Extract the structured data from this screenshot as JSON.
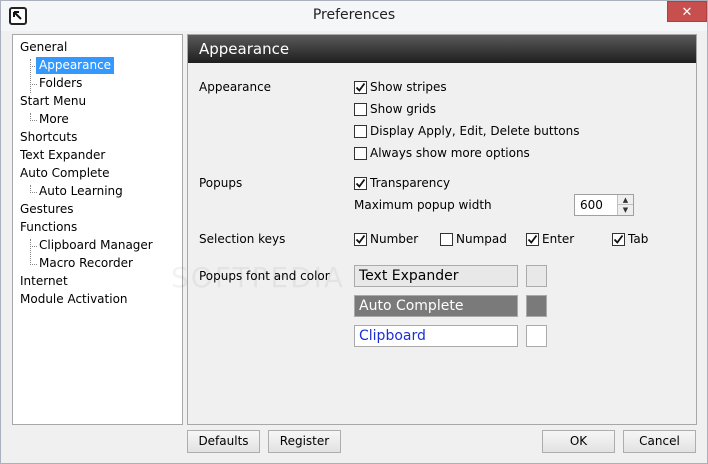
{
  "window": {
    "title": "Preferences",
    "close_glyph": "✕"
  },
  "sidebar": {
    "items": [
      {
        "label": "General",
        "level": 0
      },
      {
        "label": "Appearance",
        "level": 1,
        "selected": true
      },
      {
        "label": "Folders",
        "level": 1
      },
      {
        "label": "Start Menu",
        "level": 0
      },
      {
        "label": "More",
        "level": 1
      },
      {
        "label": "Shortcuts",
        "level": 0
      },
      {
        "label": "Text Expander",
        "level": 0
      },
      {
        "label": "Auto Complete",
        "level": 0
      },
      {
        "label": "Auto Learning",
        "level": 1
      },
      {
        "label": "Gestures",
        "level": 0
      },
      {
        "label": "Functions",
        "level": 0
      },
      {
        "label": "Clipboard Manager",
        "level": 1
      },
      {
        "label": "Macro Recorder",
        "level": 1
      },
      {
        "label": "Internet",
        "level": 0
      },
      {
        "label": "Module Activation",
        "level": 0
      }
    ]
  },
  "panel": {
    "header": "Appearance",
    "appearance": {
      "label": "Appearance",
      "options": [
        {
          "label": "Show stripes",
          "checked": true
        },
        {
          "label": "Show grids",
          "checked": false
        },
        {
          "label": "Display Apply, Edit, Delete buttons",
          "checked": false
        },
        {
          "label": "Always show more options",
          "checked": false
        }
      ]
    },
    "popups": {
      "label": "Popups",
      "transparency": {
        "label": "Transparency",
        "checked": true
      },
      "max_width_label": "Maximum popup width",
      "max_width_value": "600"
    },
    "selection_keys": {
      "label": "Selection keys",
      "options": [
        {
          "label": "Number",
          "checked": true
        },
        {
          "label": "Numpad",
          "checked": false
        },
        {
          "label": "Enter",
          "checked": true
        },
        {
          "label": "Tab",
          "checked": true
        }
      ]
    },
    "fonts": {
      "label": "Popups font and color",
      "items": [
        {
          "label": "Text Expander",
          "bg": "#e8e8e8",
          "fg": "#000000",
          "swatch": "#e8e8e8"
        },
        {
          "label": "Auto Complete",
          "bg": "#7a7a7a",
          "fg": "#ffffff",
          "swatch": "#7a7a7a"
        },
        {
          "label": "Clipboard",
          "bg": "#ffffff",
          "fg": "#1a2fd6",
          "swatch": "#ffffff"
        }
      ]
    }
  },
  "buttons": {
    "defaults": "Defaults",
    "register": "Register",
    "ok": "OK",
    "cancel": "Cancel"
  },
  "watermark": "SOFTPEDIA"
}
